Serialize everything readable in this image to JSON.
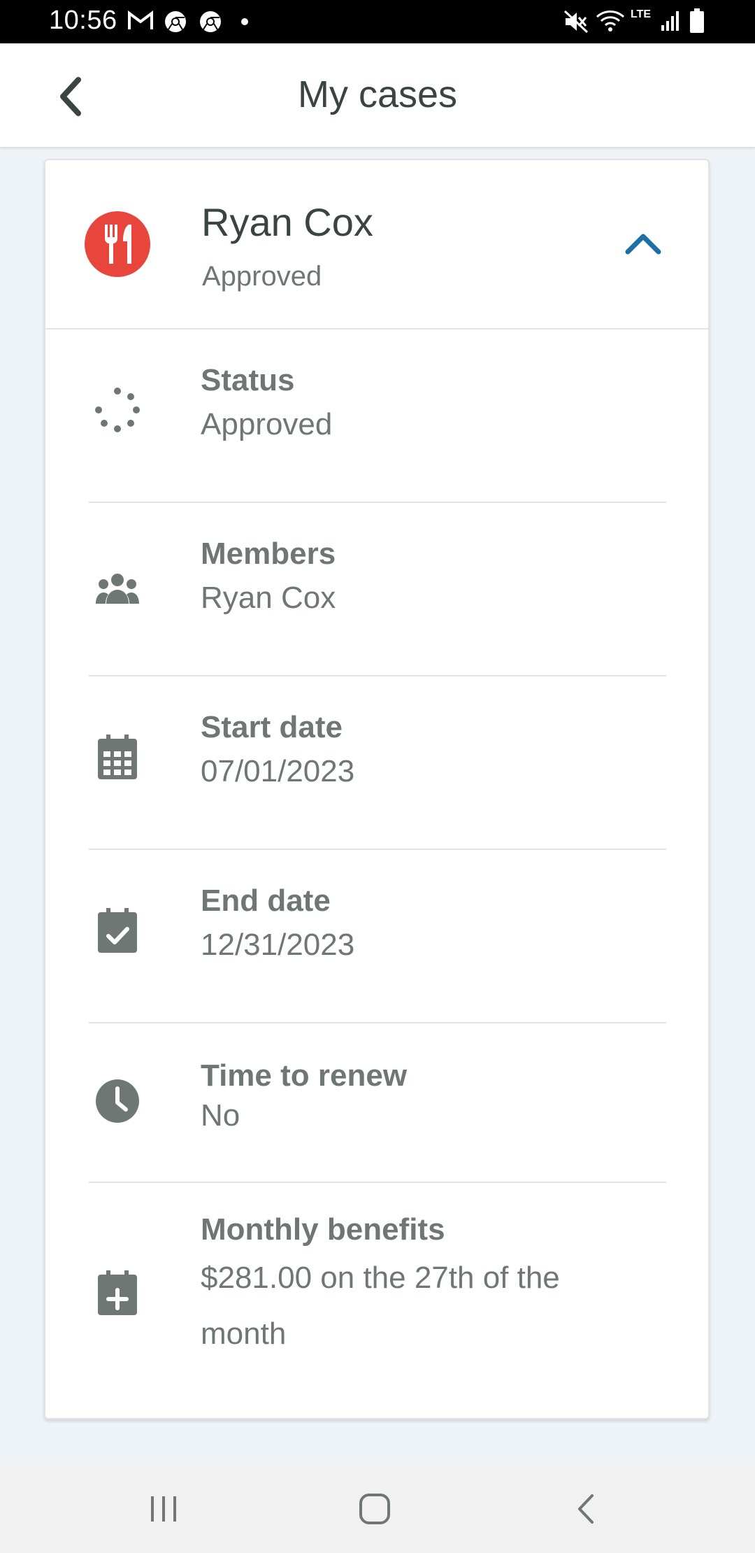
{
  "status_bar": {
    "time": "10:56",
    "icons": [
      "gmail-icon",
      "chrome-icon",
      "chrome-icon",
      "dot-icon",
      "mute-icon",
      "wifi-icon",
      "lte-icon",
      "signal-icon",
      "battery-icon"
    ],
    "network_label": "LTE"
  },
  "app_bar": {
    "title": "My cases",
    "back_icon": "chevron-left-icon"
  },
  "case": {
    "name": "Ryan Cox",
    "status": "Approved",
    "icon": "fork-knife-icon",
    "icon_bg": "#e8453c",
    "collapse_icon": "chevron-up-icon",
    "accent": "#1f6fa8"
  },
  "details": [
    {
      "icon": "loading-dots-icon",
      "label": "Status",
      "value": "Approved"
    },
    {
      "icon": "group-icon",
      "label": "Members",
      "value": "Ryan Cox"
    },
    {
      "icon": "calendar-icon",
      "label": "Start date",
      "value": "07/01/2023"
    },
    {
      "icon": "calendar-check-icon",
      "label": "End date",
      "value": "12/31/2023"
    },
    {
      "icon": "clock-icon",
      "label": "Time to renew",
      "value": "No"
    },
    {
      "icon": "calendar-plus-icon",
      "label": "Monthly benefits",
      "value": "$281.00 on the 27th of the month"
    }
  ],
  "nav": {
    "buttons": [
      "recents-icon",
      "home-icon",
      "back-icon"
    ]
  }
}
